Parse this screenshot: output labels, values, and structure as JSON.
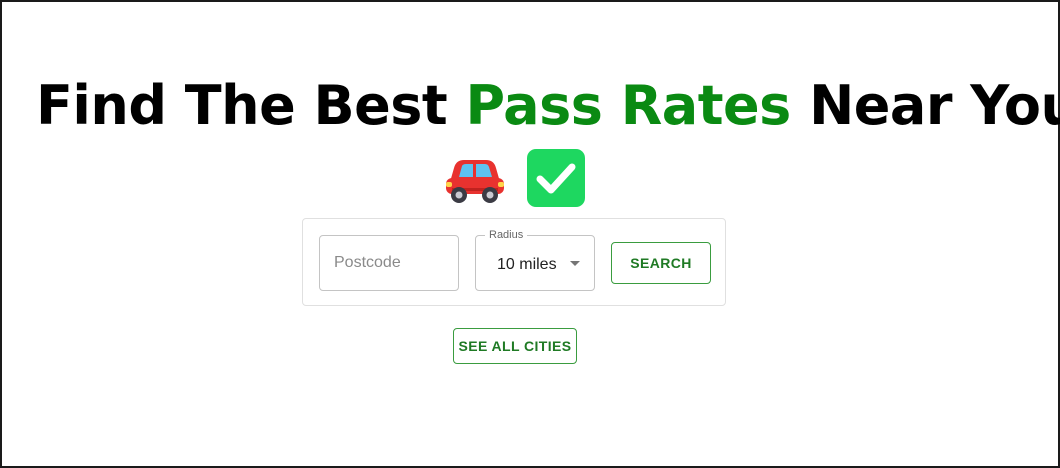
{
  "headline": {
    "before": "Find The Best ",
    "accent": "Pass Rates",
    "after": " Near You"
  },
  "icons": [
    "car-icon",
    "check-icon"
  ],
  "colors": {
    "accent": "#0a8a12",
    "button_text": "#1f7a24",
    "button_border": "#3a9c3f",
    "check_bg": "#1ed760"
  },
  "search": {
    "postcode_placeholder": "Postcode",
    "postcode_value": "",
    "radius_label": "Radius",
    "radius_value": "10 miles",
    "search_label": "SEARCH"
  },
  "see_all_label": "SEE ALL CITIES"
}
